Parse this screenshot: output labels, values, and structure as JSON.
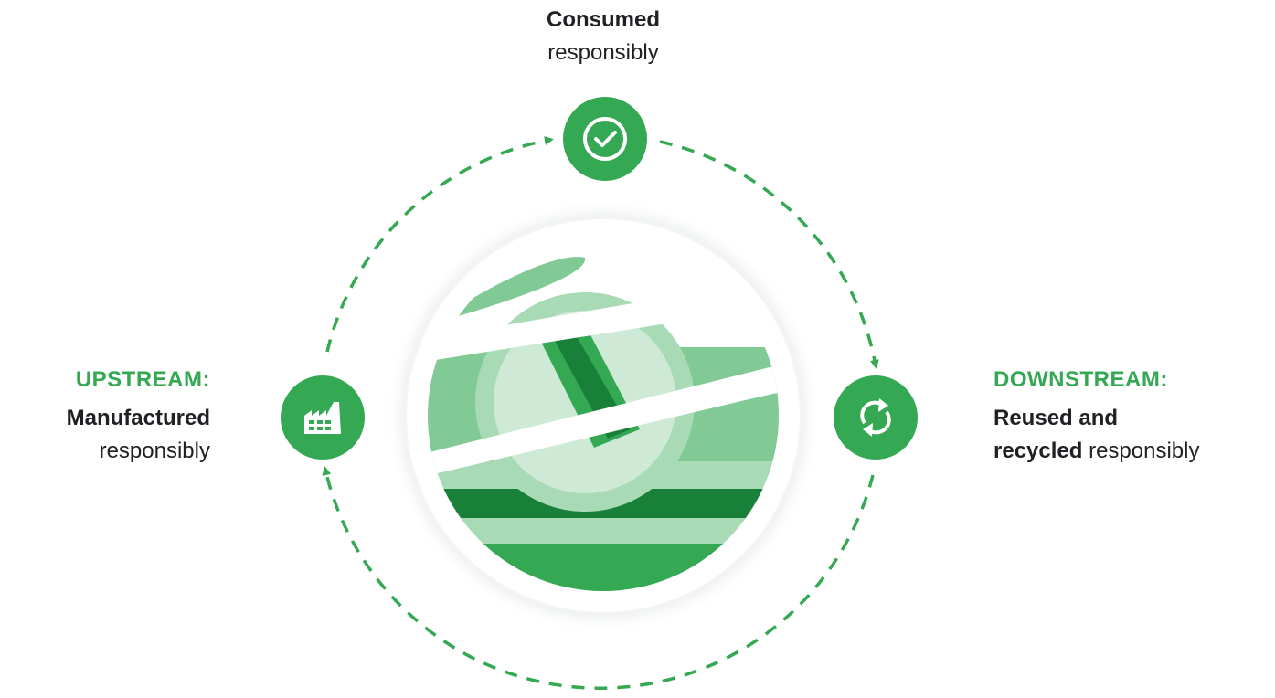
{
  "consumed": {
    "bold": "Consumed",
    "normal": "responsibly",
    "icon": "check-circle-icon"
  },
  "upstream": {
    "heading": "UPSTREAM:",
    "bold": "Manufactured",
    "normal": "responsibly",
    "icon": "factory-icon"
  },
  "downstream": {
    "heading": "DOWNSTREAM:",
    "line1_bold": "Reused and",
    "line2_bold": "recycled",
    "line2_normal": " responsibly",
    "icon": "recycle-arrows-icon"
  },
  "colors": {
    "green": "#34a853",
    "dark_green": "#188038",
    "light_green": "#81c995",
    "pale_green": "#ceead6",
    "text": "#202124"
  }
}
